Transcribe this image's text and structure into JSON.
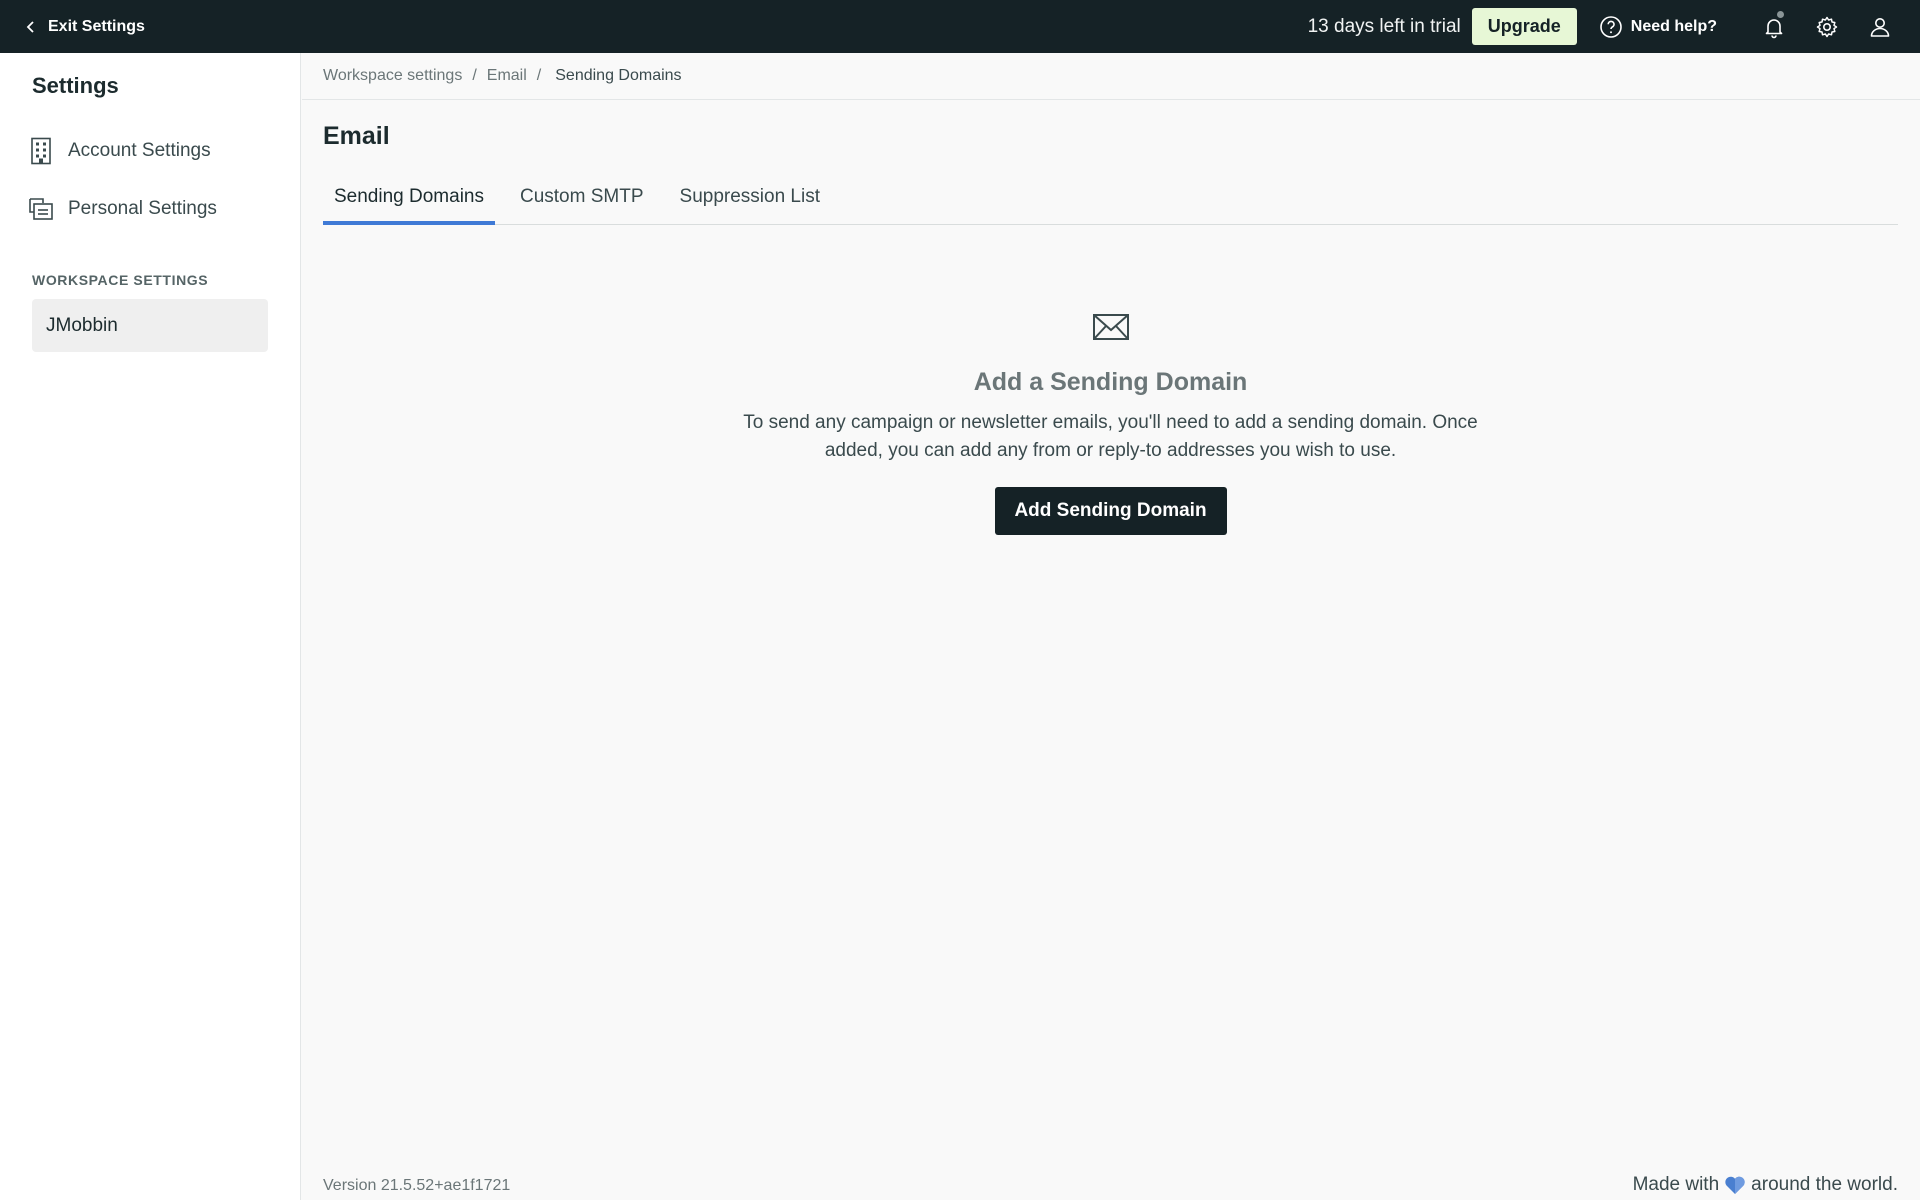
{
  "topbar": {
    "exit_label": "Exit Settings",
    "trial_text": "13 days left in trial",
    "upgrade_label": "Upgrade",
    "help_label": "Need help?"
  },
  "sidebar": {
    "title": "Settings",
    "items": [
      {
        "label": "Account Settings",
        "icon": "building-icon"
      },
      {
        "label": "Personal Settings",
        "icon": "personal-settings-icon"
      }
    ],
    "section_label": "WORKSPACE SETTINGS",
    "workspace": "JMobbin"
  },
  "breadcrumb": {
    "items": [
      "Workspace settings",
      "Email"
    ],
    "current": "Sending Domains"
  },
  "main": {
    "title": "Email",
    "tabs": [
      {
        "label": "Sending Domains",
        "active": true
      },
      {
        "label": "Custom SMTP",
        "active": false
      },
      {
        "label": "Suppression List",
        "active": false
      }
    ],
    "empty": {
      "icon": "envelope-icon",
      "title": "Add a Sending Domain",
      "text": "To send any campaign or newsletter emails, you'll need to add a sending domain. Once added, you can add any from or reply-to addresses you wish to use.",
      "button_label": "Add Sending Domain"
    }
  },
  "footer": {
    "version": "Version 21.5.52+ae1f1721",
    "made_before": "Made with",
    "made_after": "around the world.",
    "heart_color": "#4a7fd0"
  },
  "colors": {
    "topbar_bg": "#152226",
    "upgrade_bg": "#e7f7d6",
    "tab_accent": "#3f7ad6",
    "primary_button": "#152226"
  }
}
